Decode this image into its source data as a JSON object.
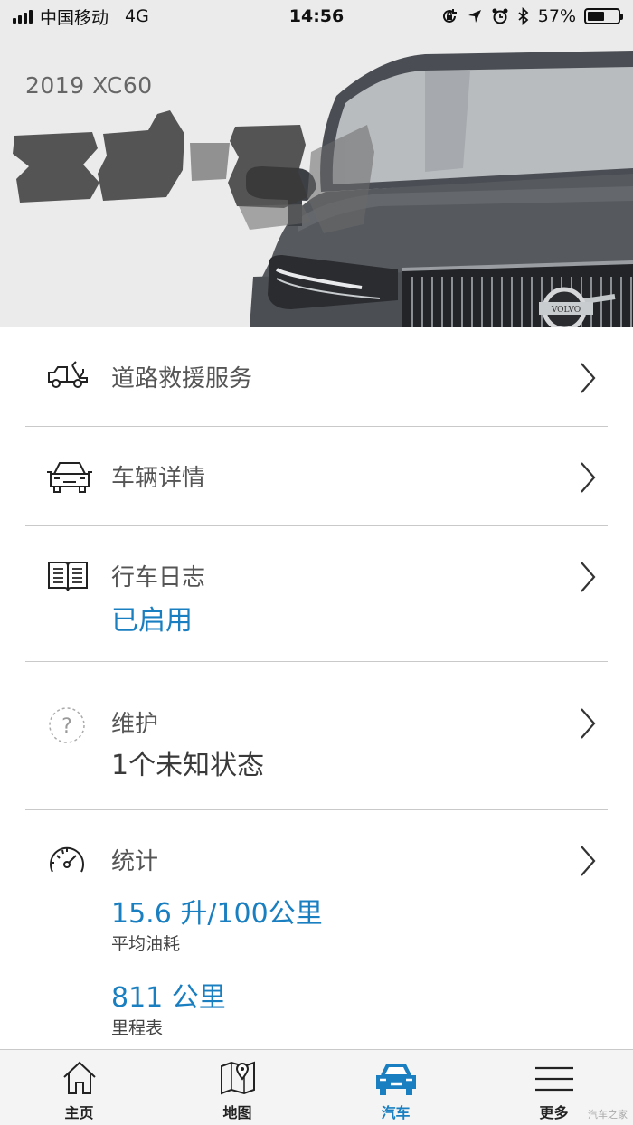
{
  "status_bar": {
    "carrier": "中国移动",
    "network": "4G",
    "time": "14:56",
    "battery": "57%",
    "battery_level": 0.57
  },
  "hero": {
    "model_title": "2019 XC60",
    "grille_badge": "VOLVO"
  },
  "menu": {
    "roadside": {
      "label": "道路救援服务",
      "icon": "tow-truck-icon"
    },
    "vehicle": {
      "label": "车辆详情",
      "icon": "car-front-icon"
    },
    "journal": {
      "label": "行车日志",
      "value": "已启用",
      "icon": "logbook-icon"
    },
    "maintenance": {
      "label": "维护",
      "value": "1个未知状态",
      "icon": "question-circle-icon"
    },
    "statistics": {
      "label": "统计",
      "icon": "speedometer-icon",
      "fuel_value": "15.6 升/100公里",
      "fuel_label": "平均油耗",
      "odometer_value": "811 公里",
      "odometer_label": "里程表"
    }
  },
  "tabs": [
    {
      "label": "主页",
      "icon": "home-icon"
    },
    {
      "label": "地图",
      "icon": "map-icon"
    },
    {
      "label": "汽车",
      "icon": "car-icon",
      "active": true
    },
    {
      "label": "更多",
      "icon": "menu-icon"
    }
  ],
  "watermark": "汽车之家",
  "colors": {
    "accent": "#1a7fc0",
    "divider": "#c9c9c9",
    "hero_bg": "#ebebeb"
  }
}
